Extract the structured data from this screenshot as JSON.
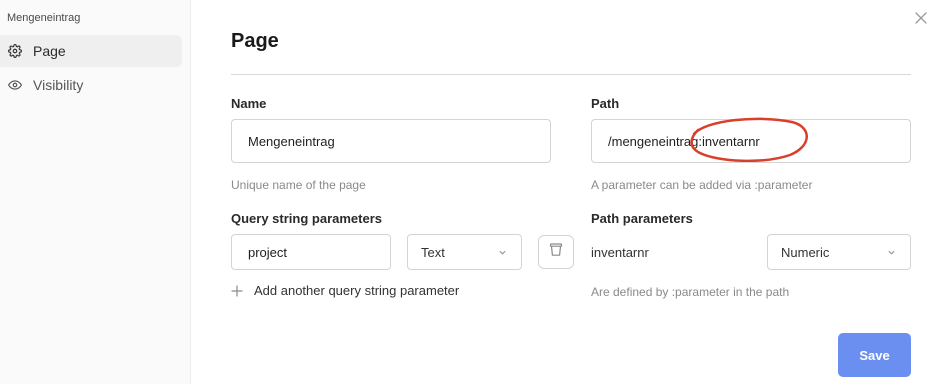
{
  "sidebar": {
    "title": "Mengeneintrag",
    "items": [
      {
        "label": "Page",
        "icon": "gear-icon",
        "active": true
      },
      {
        "label": "Visibility",
        "icon": "eye-icon",
        "active": false
      }
    ]
  },
  "dialog": {
    "title": "Page",
    "name_field": {
      "label": "Name",
      "value": "Mengeneintrag",
      "help": "Unique name of the page"
    },
    "path_field": {
      "label": "Path",
      "value": "/mengeneintrag:inventarnr",
      "help": "A parameter can be added via :parameter"
    },
    "query_params": {
      "label": "Query string parameters",
      "rows": [
        {
          "name": "project",
          "type": "Text"
        }
      ],
      "add_label": "Add another query string parameter"
    },
    "path_params": {
      "label": "Path parameters",
      "rows": [
        {
          "name": "inventarnr",
          "type": "Numeric"
        }
      ],
      "help": "Are defined by :parameter in the path"
    },
    "save_label": "Save"
  },
  "colors": {
    "accent": "#6b8ff0",
    "annotation": "#d8402a"
  }
}
